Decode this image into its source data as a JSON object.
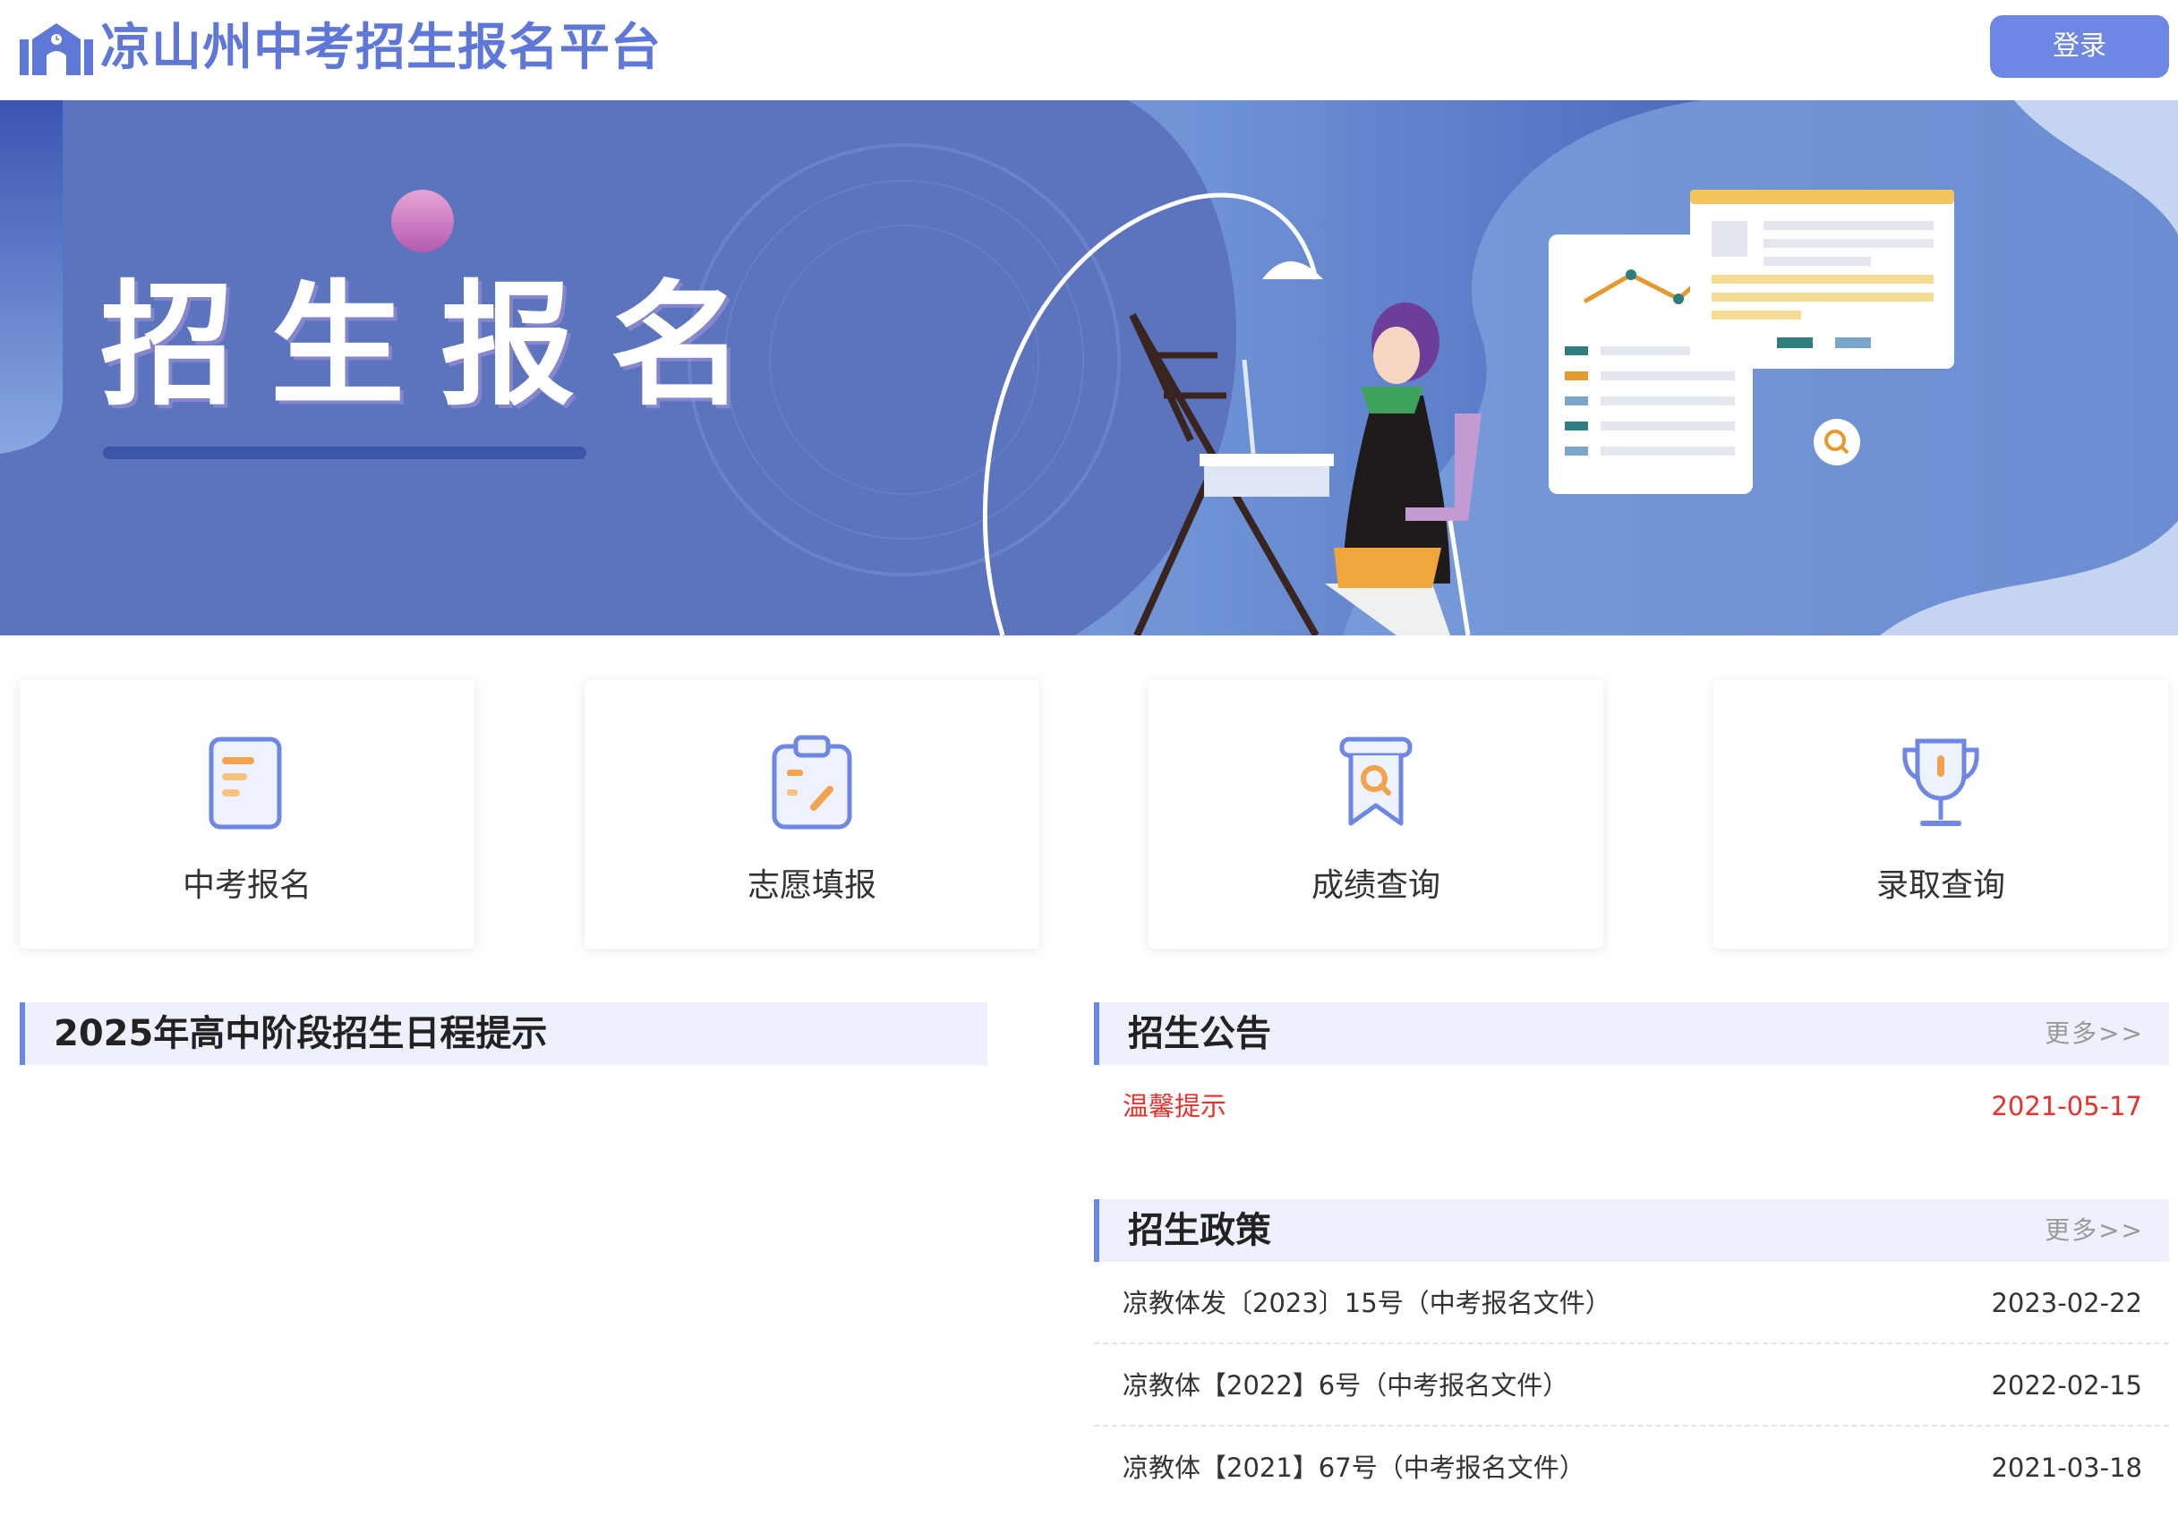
{
  "header": {
    "site_title": "凉山州中考招生报名平台",
    "login_label": "登录"
  },
  "banner": {
    "title": "招生报名"
  },
  "cards": [
    {
      "label": "中考报名",
      "icon": "document-icon"
    },
    {
      "label": "志愿填报",
      "icon": "clipboard-edit-icon"
    },
    {
      "label": "成绩查询",
      "icon": "bookmark-search-icon"
    },
    {
      "label": "录取查询",
      "icon": "trophy-icon"
    }
  ],
  "schedule": {
    "title": "2025年高中阶段招生日程提示"
  },
  "notices": {
    "title": "招生公告",
    "more_label": "更多>>",
    "items": [
      {
        "title": "温馨提示",
        "date": "2021-05-17"
      }
    ]
  },
  "policies": {
    "title": "招生政策",
    "more_label": "更多>>",
    "items": [
      {
        "title": "凉教体发〔2023〕15号（中考报名文件）",
        "date": "2023-02-22"
      },
      {
        "title": "凉教体【2022】6号（中考报名文件）",
        "date": "2022-02-15"
      },
      {
        "title": "凉教体【2021】67号（中考报名文件）",
        "date": "2021-03-18"
      }
    ]
  },
  "colors": {
    "accent": "#6e86e4",
    "title_blue": "#5f78d8",
    "hot_red": "#e8312b",
    "section_bg": "#eef1fb"
  }
}
